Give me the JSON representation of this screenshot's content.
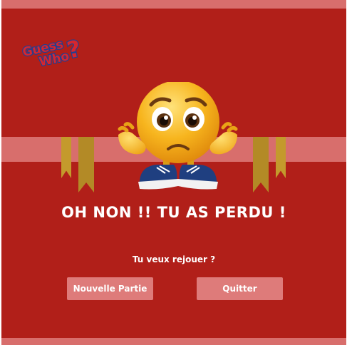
{
  "logo": {
    "line1": "Guess",
    "line2": "Who",
    "mark": "?"
  },
  "emoji": {
    "icon": "worried-shrugging-emoji-icon"
  },
  "game_over": {
    "headline": "OH NON !! TU AS PERDU !",
    "prompt": "Tu veux rejouer ?"
  },
  "buttons": {
    "new_game": "Nouvelle Partie",
    "quit": "Quitter"
  },
  "colors": {
    "background": "#b11f19",
    "stripe": "#f0a0a0",
    "ribbon_gold": "#c49a2c",
    "logo_red": "#d7262e",
    "logo_blue": "#1f3f93",
    "emoji_yellow": "#f7b51e"
  }
}
